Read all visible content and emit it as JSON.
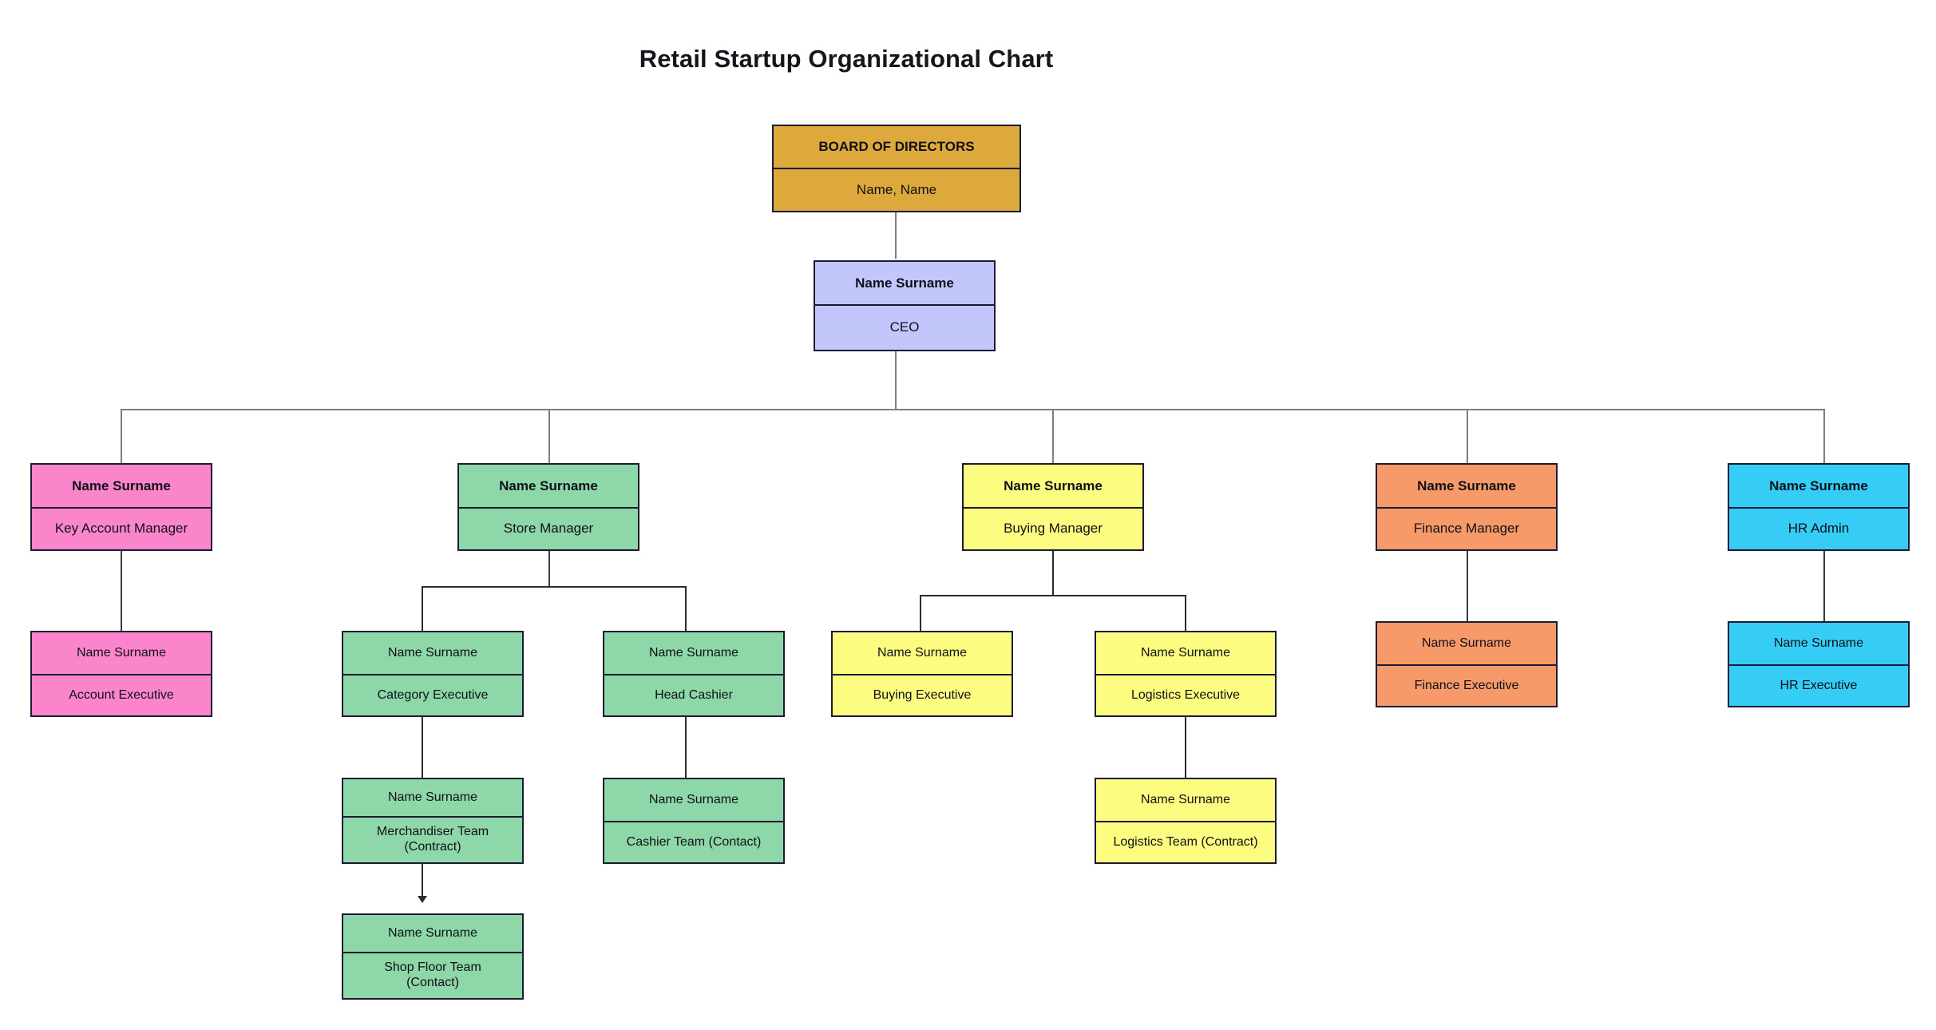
{
  "title": "Retail Startup Organizational Chart",
  "palette": {
    "board": "#dda93c",
    "ceo": "#c2c6fb",
    "sales": "#fa85cb",
    "store": "#8ed7a9",
    "buying": "#fcfc80",
    "finance": "#f79a69",
    "hr": "#35cdf5",
    "border": "#1b1b33",
    "connector_light": "#7e7e7e",
    "connector_dark": "#2a2a33",
    "background": "#ffffff",
    "text": "#101018"
  },
  "nodes": {
    "board": {
      "name": "BOARD OF DIRECTORS",
      "role": "Name, Name"
    },
    "ceo": {
      "name": "Name Surname",
      "role": "CEO"
    },
    "key_account_manager": {
      "name": "Name Surname",
      "role": "Key Account Manager"
    },
    "account_executive": {
      "name": "Name Surname",
      "role": "Account Executive"
    },
    "store_manager": {
      "name": "Name Surname",
      "role": "Store Manager"
    },
    "category_executive": {
      "name": "Name Surname",
      "role": "Category Executive"
    },
    "merchandiser_team": {
      "name": "Name Surname",
      "role": "Merchandiser Team\n(Contract)"
    },
    "shop_floor_team": {
      "name": "Name Surname",
      "role": "Shop Floor Team\n(Contact)"
    },
    "head_cashier": {
      "name": "Name Surname",
      "role": "Head Cashier"
    },
    "cashier_team": {
      "name": "Name Surname",
      "role": "Cashier Team (Contact)"
    },
    "buying_manager": {
      "name": "Name Surname",
      "role": "Buying Manager"
    },
    "buying_executive": {
      "name": "Name Surname",
      "role": "Buying Executive"
    },
    "logistics_executive": {
      "name": "Name Surname",
      "role": "Logistics Executive"
    },
    "logistics_team": {
      "name": "Name Surname",
      "role": "Logistics Team (Contract)"
    },
    "finance_manager": {
      "name": "Name Surname",
      "role": "Finance Manager"
    },
    "finance_executive": {
      "name": "Name Surname",
      "role": "Finance Executive"
    },
    "hr_admin": {
      "name": "Name Surname",
      "role": "HR Admin"
    },
    "hr_executive": {
      "name": "Name Surname",
      "role": "HR Executive"
    }
  },
  "chart_data": {
    "type": "diagram",
    "diagram_type": "organizational-chart",
    "title": "Retail Startup Organizational Chart",
    "hierarchy": [
      {
        "id": "board",
        "name": "BOARD OF DIRECTORS",
        "role": "Name, Name",
        "color": "#dda93c",
        "level": 0,
        "children": [
          {
            "id": "ceo",
            "name": "Name Surname",
            "role": "CEO",
            "color": "#c2c6fb",
            "level": 1,
            "children": [
              {
                "id": "key_account_manager",
                "name": "Name Surname",
                "role": "Key Account Manager",
                "color": "#fa85cb",
                "level": 2,
                "children": [
                  {
                    "id": "account_executive",
                    "name": "Name Surname",
                    "role": "Account Executive",
                    "color": "#fa85cb",
                    "level": 3,
                    "children": []
                  }
                ]
              },
              {
                "id": "store_manager",
                "name": "Name Surname",
                "role": "Store Manager",
                "color": "#8ed7a9",
                "level": 2,
                "children": [
                  {
                    "id": "category_executive",
                    "name": "Name Surname",
                    "role": "Category Executive",
                    "color": "#8ed7a9",
                    "level": 3,
                    "children": [
                      {
                        "id": "merchandiser_team",
                        "name": "Name Surname",
                        "role": "Merchandiser Team (Contract)",
                        "color": "#8ed7a9",
                        "level": 4,
                        "children": [
                          {
                            "id": "shop_floor_team",
                            "name": "Name Surname",
                            "role": "Shop Floor Team (Contact)",
                            "color": "#8ed7a9",
                            "level": 5,
                            "children": [],
                            "edge_style": "arrow"
                          }
                        ]
                      }
                    ]
                  },
                  {
                    "id": "head_cashier",
                    "name": "Name Surname",
                    "role": "Head Cashier",
                    "color": "#8ed7a9",
                    "level": 3,
                    "children": [
                      {
                        "id": "cashier_team",
                        "name": "Name Surname",
                        "role": "Cashier Team (Contact)",
                        "color": "#8ed7a9",
                        "level": 4,
                        "children": []
                      }
                    ]
                  }
                ]
              },
              {
                "id": "buying_manager",
                "name": "Name Surname",
                "role": "Buying Manager",
                "color": "#fcfc80",
                "level": 2,
                "children": [
                  {
                    "id": "buying_executive",
                    "name": "Name Surname",
                    "role": "Buying Executive",
                    "color": "#fcfc80",
                    "level": 3,
                    "children": []
                  },
                  {
                    "id": "logistics_executive",
                    "name": "Name Surname",
                    "role": "Logistics Executive",
                    "color": "#fcfc80",
                    "level": 3,
                    "children": [
                      {
                        "id": "logistics_team",
                        "name": "Name Surname",
                        "role": "Logistics Team (Contract)",
                        "color": "#fcfc80",
                        "level": 4,
                        "children": []
                      }
                    ]
                  }
                ]
              },
              {
                "id": "finance_manager",
                "name": "Name Surname",
                "role": "Finance Manager",
                "color": "#f79a69",
                "level": 2,
                "children": [
                  {
                    "id": "finance_executive",
                    "name": "Name Surname",
                    "role": "Finance Executive",
                    "color": "#f79a69",
                    "level": 3,
                    "children": []
                  }
                ]
              },
              {
                "id": "hr_admin",
                "name": "Name Surname",
                "role": "HR Admin",
                "color": "#35cdf5",
                "level": 2,
                "children": [
                  {
                    "id": "hr_executive",
                    "name": "Name Surname",
                    "role": "HR Executive",
                    "color": "#35cdf5",
                    "level": 3,
                    "children": []
                  }
                ]
              }
            ]
          }
        ]
      }
    ],
    "node_count": 18,
    "depth": 6
  }
}
